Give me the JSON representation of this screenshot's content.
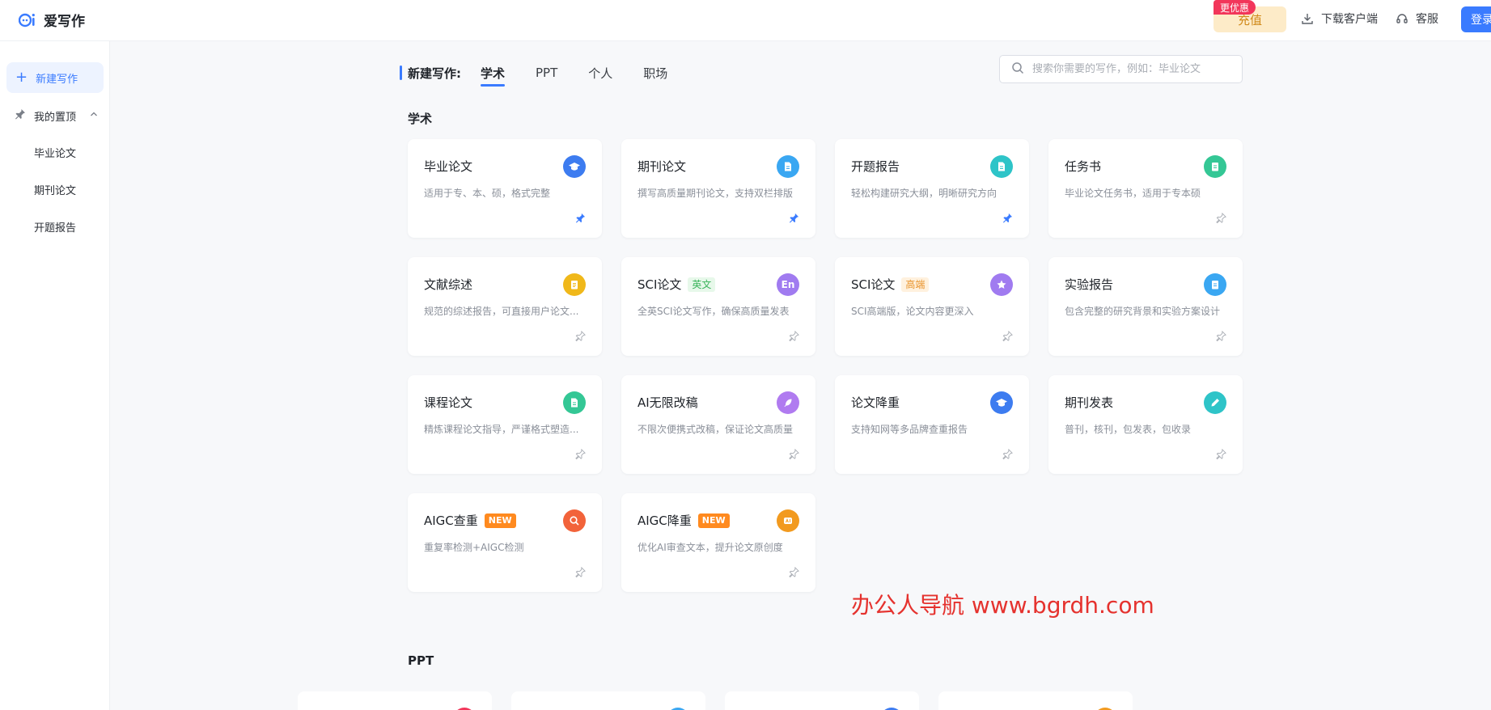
{
  "app": {
    "name": "爱写作"
  },
  "header": {
    "recharge_label": "充值",
    "promo_badge": "更优惠",
    "download_label": "下载客户端",
    "service_label": "客服",
    "login_label": "登录"
  },
  "sidebar": {
    "new_label": "新建写作",
    "pinned_label": "我的置顶",
    "items": [
      {
        "label": "毕业论文"
      },
      {
        "label": "期刊论文"
      },
      {
        "label": "开题报告"
      }
    ]
  },
  "main": {
    "tabs_title": "新建写作:",
    "tabs": [
      {
        "label": "学术",
        "active": true
      },
      {
        "label": "PPT",
        "active": false
      },
      {
        "label": "个人",
        "active": false
      },
      {
        "label": "职场",
        "active": false
      }
    ],
    "search_placeholder": "搜索你需要的写作，例如：毕业论文",
    "sections": [
      {
        "title": "学术",
        "cards": [
          {
            "title": "毕业论文",
            "desc": "适用于专、本、硕，格式完整",
            "icon": "graduation-cap-icon",
            "icon_color": "#3d7cf0",
            "pinned": true
          },
          {
            "title": "期刊论文",
            "desc": "撰写高质量期刊论文，支持双栏排版",
            "icon": "document-icon",
            "icon_color": "#3aa7f2",
            "pinned": true
          },
          {
            "title": "开题报告",
            "desc": "轻松构建研究大纲，明晰研究方向",
            "icon": "document-icon",
            "icon_color": "#2ec4c8",
            "pinned": true
          },
          {
            "title": "任务书",
            "desc": "毕业论文任务书，适用于专本硕",
            "icon": "clipboard-icon",
            "icon_color": "#34c795",
            "pinned": false
          },
          {
            "title": "文献综述",
            "desc": "规范的综述报告，可直接用户论文...",
            "icon": "list-document-icon",
            "icon_color": "#f0b81a",
            "pinned": false
          },
          {
            "title": "SCI论文",
            "tag": "英文",
            "tag_type": "en",
            "desc": "全英SCI论文写作，确保高质量发表",
            "icon": "en-letters-icon",
            "icon_text": "En",
            "icon_color": "#a07bf0",
            "pinned": false
          },
          {
            "title": "SCI论文",
            "tag": "高端",
            "tag_type": "hi",
            "desc": "SCI高端版，论文内容更深入",
            "icon": "star-icon",
            "icon_color": "#a07bf0",
            "pinned": false
          },
          {
            "title": "实验报告",
            "desc": "包含完整的研究背景和实验方案设计",
            "icon": "clipboard-icon",
            "icon_color": "#3aa7f2",
            "pinned": false
          },
          {
            "title": "课程论文",
            "desc": "精炼课程论文指导，严谨格式塑造...",
            "icon": "document-icon",
            "icon_color": "#34c795",
            "pinned": false
          },
          {
            "title": "AI无限改稿",
            "desc": "不限次便携式改稿，保证论文高质量",
            "icon": "feather-icon",
            "icon_color": "#b07bf0",
            "pinned": false
          },
          {
            "title": "论文降重",
            "desc": "支持知网等多品牌查重报告",
            "icon": "graduation-cap-icon",
            "icon_color": "#3d7cf0",
            "pinned": false
          },
          {
            "title": "期刊发表",
            "desc": "普刊，核刊，包发表，包收录",
            "icon": "pen-icon",
            "icon_color": "#2ec4c8",
            "pinned": false
          },
          {
            "title": "AIGC查重",
            "tag": "NEW",
            "tag_type": "new",
            "desc": "重复率检测+AIGC检测",
            "icon": "search-icon",
            "icon_color": "#f2633a",
            "pinned": false
          },
          {
            "title": "AIGC降重",
            "tag": "NEW",
            "tag_type": "new",
            "desc": "优化AI审查文本，提升论文原创度",
            "icon": "ai-badge-icon",
            "icon_color": "#f29a1f",
            "pinned": false
          }
        ]
      },
      {
        "title": "PPT"
      }
    ]
  },
  "watermark": "办公人导航 www.bgrdh.com",
  "ppt_partial_icon_colors": [
    "#f2365a",
    "#3aa7f2",
    "#3d7cf0",
    "#f29a1f"
  ]
}
